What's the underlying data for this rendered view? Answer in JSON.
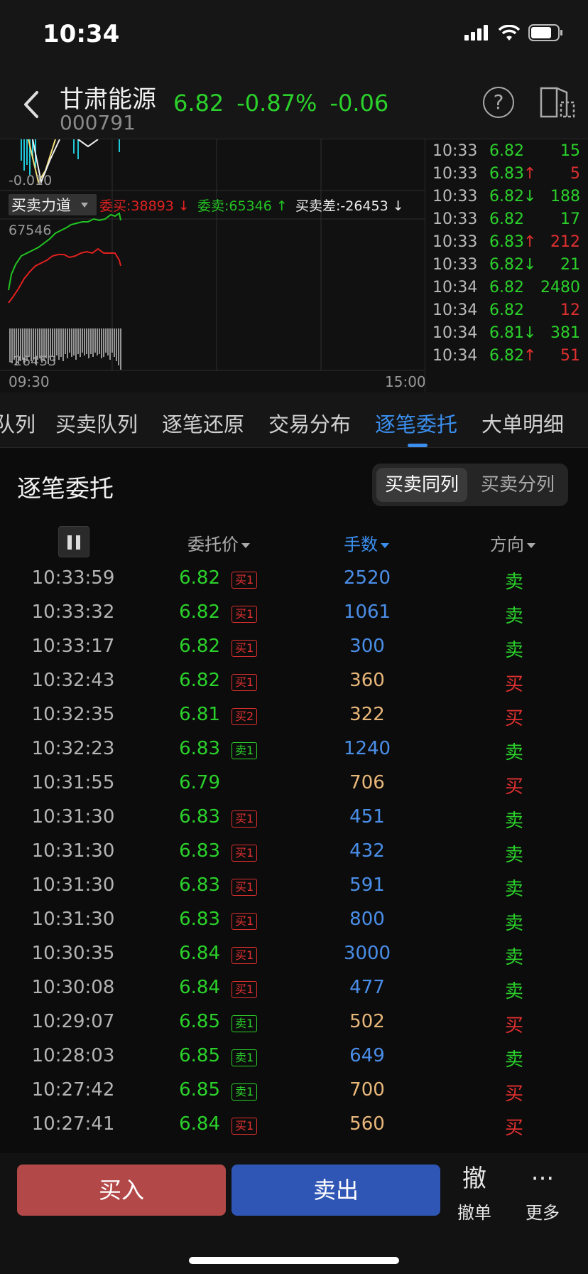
{
  "status_bar": {
    "time": "10:34"
  },
  "header": {
    "stock_name": "甘肃能源",
    "stock_code": "000791",
    "price": "6.82",
    "change_pct": "-0.87%",
    "change": "-0.06",
    "help_glyph": "?"
  },
  "chart": {
    "upper_axis_label": "-0.010",
    "indicator_name": "买卖力道",
    "indicator_buy": "委买:38893 ↓",
    "indicator_sell": "委卖:65346 ↑",
    "indicator_diff": "买卖差:-26453 ↓",
    "top_value": "67546",
    "bottom_value": "-26453",
    "time_start": "09:30",
    "time_end": "15:00",
    "colors": {
      "buy_line": "#e02020",
      "sell_line": "#22c422",
      "up": "#e03030",
      "down": "#2bd12b"
    }
  },
  "ticks": [
    {
      "time": "10:33",
      "price": "6.82",
      "arrow": "",
      "vol": "15",
      "vol_color": "down"
    },
    {
      "time": "10:33",
      "price": "6.83",
      "arrow": "↑",
      "vol": "5",
      "vol_color": "up"
    },
    {
      "time": "10:33",
      "price": "6.82",
      "arrow": "↓",
      "vol": "188",
      "vol_color": "down"
    },
    {
      "time": "10:33",
      "price": "6.82",
      "arrow": "",
      "vol": "17",
      "vol_color": "down"
    },
    {
      "time": "10:33",
      "price": "6.83",
      "arrow": "↑",
      "vol": "212",
      "vol_color": "up"
    },
    {
      "time": "10:33",
      "price": "6.82",
      "arrow": "↓",
      "vol": "21",
      "vol_color": "down"
    },
    {
      "time": "10:34",
      "price": "6.82",
      "arrow": "",
      "vol": "2480",
      "vol_color": "down"
    },
    {
      "time": "10:34",
      "price": "6.82",
      "arrow": "",
      "vol": "12",
      "vol_color": "up"
    },
    {
      "time": "10:34",
      "price": "6.81",
      "arrow": "↓",
      "vol": "381",
      "vol_color": "down"
    },
    {
      "time": "10:34",
      "price": "6.82",
      "arrow": "↑",
      "vol": "51",
      "vol_color": "up"
    }
  ],
  "subtabs": [
    "队列",
    "买卖队列",
    "逐笔还原",
    "交易分布",
    "逐笔委托",
    "大单明细"
  ],
  "active_subtab": "逐笔委托",
  "section": {
    "title": "逐笔委托",
    "seg_on": "买卖同列",
    "seg_off": "买卖分列",
    "col_price": "委托价",
    "col_qty": "手数",
    "col_dir": "方向"
  },
  "orders": [
    {
      "time": "10:33:59",
      "price": "6.82",
      "badge": "买1",
      "badge_type": "buy",
      "qty": "2520",
      "qty_color": "#4a8ee8",
      "dir": "卖",
      "dir_color": "#2bd12b"
    },
    {
      "time": "10:33:32",
      "price": "6.82",
      "badge": "买1",
      "badge_type": "buy",
      "qty": "1061",
      "qty_color": "#4a8ee8",
      "dir": "卖",
      "dir_color": "#2bd12b"
    },
    {
      "time": "10:33:17",
      "price": "6.82",
      "badge": "买1",
      "badge_type": "buy",
      "qty": "300",
      "qty_color": "#4a8ee8",
      "dir": "卖",
      "dir_color": "#2bd12b"
    },
    {
      "time": "10:32:43",
      "price": "6.82",
      "badge": "买1",
      "badge_type": "buy",
      "qty": "360",
      "qty_color": "#e8b77a",
      "dir": "买",
      "dir_color": "#e03030"
    },
    {
      "time": "10:32:35",
      "price": "6.81",
      "badge": "买2",
      "badge_type": "buy",
      "qty": "322",
      "qty_color": "#e8b77a",
      "dir": "买",
      "dir_color": "#e03030"
    },
    {
      "time": "10:32:23",
      "price": "6.83",
      "badge": "卖1",
      "badge_type": "sell",
      "qty": "1240",
      "qty_color": "#4a8ee8",
      "dir": "卖",
      "dir_color": "#2bd12b"
    },
    {
      "time": "10:31:55",
      "price": "6.79",
      "badge": "",
      "badge_type": "",
      "qty": "706",
      "qty_color": "#e8b77a",
      "dir": "买",
      "dir_color": "#e03030"
    },
    {
      "time": "10:31:30",
      "price": "6.83",
      "badge": "买1",
      "badge_type": "buy",
      "qty": "451",
      "qty_color": "#4a8ee8",
      "dir": "卖",
      "dir_color": "#2bd12b"
    },
    {
      "time": "10:31:30",
      "price": "6.83",
      "badge": "买1",
      "badge_type": "buy",
      "qty": "432",
      "qty_color": "#4a8ee8",
      "dir": "卖",
      "dir_color": "#2bd12b"
    },
    {
      "time": "10:31:30",
      "price": "6.83",
      "badge": "买1",
      "badge_type": "buy",
      "qty": "591",
      "qty_color": "#4a8ee8",
      "dir": "卖",
      "dir_color": "#2bd12b"
    },
    {
      "time": "10:31:30",
      "price": "6.83",
      "badge": "买1",
      "badge_type": "buy",
      "qty": "800",
      "qty_color": "#4a8ee8",
      "dir": "卖",
      "dir_color": "#2bd12b"
    },
    {
      "time": "10:30:35",
      "price": "6.84",
      "badge": "买1",
      "badge_type": "buy",
      "qty": "3000",
      "qty_color": "#4a8ee8",
      "dir": "卖",
      "dir_color": "#2bd12b"
    },
    {
      "time": "10:30:08",
      "price": "6.84",
      "badge": "买1",
      "badge_type": "buy",
      "qty": "477",
      "qty_color": "#4a8ee8",
      "dir": "卖",
      "dir_color": "#2bd12b"
    },
    {
      "time": "10:29:07",
      "price": "6.85",
      "badge": "卖1",
      "badge_type": "sell",
      "qty": "502",
      "qty_color": "#e8b77a",
      "dir": "买",
      "dir_color": "#e03030"
    },
    {
      "time": "10:28:03",
      "price": "6.85",
      "badge": "卖1",
      "badge_type": "sell",
      "qty": "649",
      "qty_color": "#4a8ee8",
      "dir": "卖",
      "dir_color": "#2bd12b"
    },
    {
      "time": "10:27:42",
      "price": "6.85",
      "badge": "卖1",
      "badge_type": "sell",
      "qty": "700",
      "qty_color": "#e8b77a",
      "dir": "买",
      "dir_color": "#e03030"
    },
    {
      "time": "10:27:41",
      "price": "6.84",
      "badge": "买1",
      "badge_type": "buy",
      "qty": "560",
      "qty_color": "#e8b77a",
      "dir": "买",
      "dir_color": "#e03030"
    }
  ],
  "bottom": {
    "buy": "买入",
    "sell": "卖出",
    "cancel_icon": "撤",
    "cancel_label": "撤单",
    "more_icon": "···",
    "more_label": "更多"
  }
}
